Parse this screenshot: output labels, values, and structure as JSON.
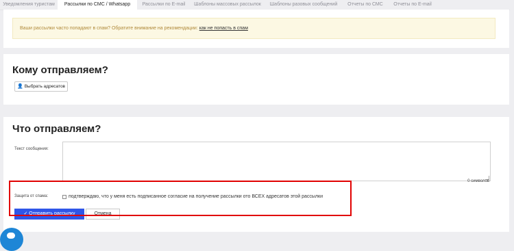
{
  "tabs": [
    {
      "label": "Уведомления туристам"
    },
    {
      "label": "Рассылки по СМС / Whatsapp"
    },
    {
      "label": "Рассылки по E-mail"
    },
    {
      "label": "Шаблоны массовых рассылок"
    },
    {
      "label": "Шаблоны разовых сообщений"
    },
    {
      "label": "Отчеты по СМС"
    },
    {
      "label": "Отчеты по E-mail"
    }
  ],
  "alert": {
    "text": "Ваши рассылки часто попадают в спам? Обратите внимание на рекомендации:",
    "link": "как не попасть в спам"
  },
  "recipients": {
    "title": "Кому отправляем?",
    "button_label": "Выбрать адресатов",
    "button_icon": "user-icon"
  },
  "content": {
    "title": "Что отправляем?",
    "message_label": "Текст сообщения:",
    "message_value": "",
    "counter": "0 символов",
    "spam_label": "Защита от спама:",
    "consent_text": "подтверждаю, что у меня есть подписанное согласие на получение рассылки ото ВСЕХ адресатов этой рассылки",
    "send_button": "✓ Отправить рассылку",
    "cancel_button": "Отмена"
  },
  "colors": {
    "primary": "#2f56e8",
    "highlight": "#e10000",
    "alert_bg": "#fcf8e3",
    "chat": "#1e86d6"
  }
}
